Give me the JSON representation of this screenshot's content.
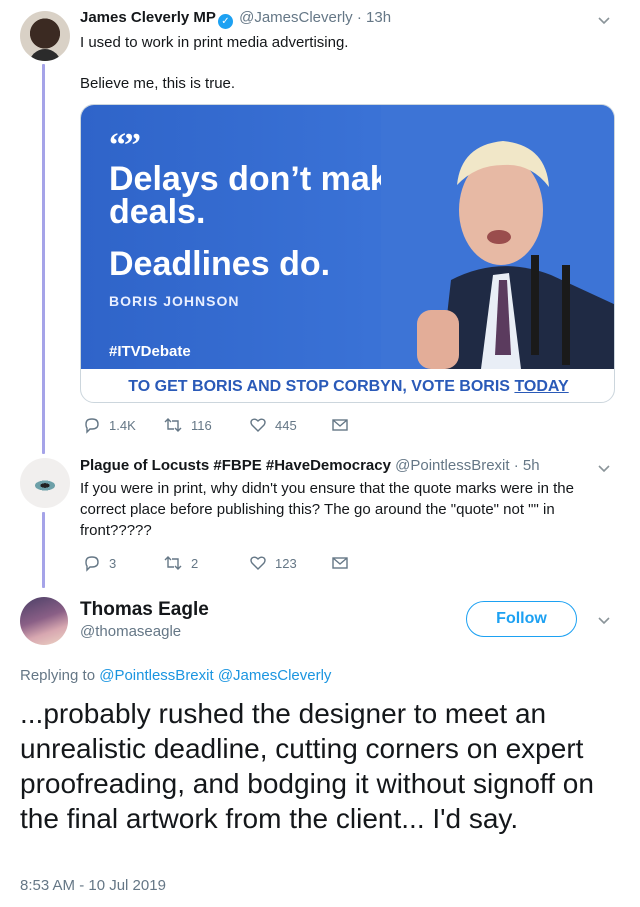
{
  "tweets": [
    {
      "name": "James Cleverly MP",
      "handle": "@JamesCleverly",
      "time": "13h",
      "text_lines": [
        "I used to work in print media advertising.",
        "Believe me, this is true."
      ],
      "card": {
        "quote_mark": "“”",
        "headline": "Delays don’t make deals.",
        "headline2": "Deadlines do.",
        "author": "BORIS JOHNSON",
        "hashtag": "#ITVDebate",
        "banner_main": "TO GET BORIS AND STOP CORBYN, VOTE BORIS",
        "banner_underlined": "TODAY"
      },
      "stats": {
        "replies": "1.4K",
        "retweets": "116",
        "likes": "445"
      }
    },
    {
      "name": "Plague of Locusts #FBPE #HaveDemocracy",
      "handle": "@PointlessBrexit",
      "time": "5h",
      "text": "If you were in print, why didn't you ensure that the quote marks were in the correct place before publishing this?  The go around the \"quote\" not \"\" in front?????",
      "stats": {
        "replies": "3",
        "retweets": "2",
        "likes": "123"
      }
    }
  ],
  "focus": {
    "name": "Thomas Eagle",
    "handle": "@thomaseagle",
    "follow_label": "Follow",
    "replying_prefix": "Replying to",
    "replying_to": [
      "@PointlessBrexit",
      "@JamesCleverly"
    ],
    "text": "...probably rushed the designer to meet an unrealistic deadline, cutting corners on expert proofreading, and bodging it without signoff on the final artwork from the client... I'd say.",
    "timestamp": "8:53 AM - 10 Jul 2019"
  },
  "separator": "·",
  "icons": [
    "verified-badge-icon",
    "chevron-down-icon",
    "reply-icon",
    "retweet-icon",
    "like-icon",
    "direct-message-icon"
  ],
  "colors": {
    "accent": "#1da1f2",
    "thread_line": "#a5a3e8",
    "card_blue": "#3a72d6",
    "muted": "#657786"
  }
}
